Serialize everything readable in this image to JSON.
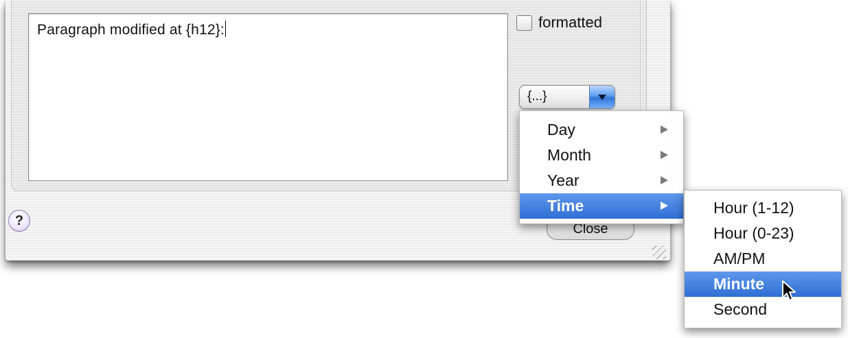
{
  "editor": {
    "text": "Paragraph modified at {h12}:"
  },
  "options": {
    "formatted_label": "formatted",
    "formatted_checked": false
  },
  "token_popup": {
    "value": "{...}"
  },
  "buttons": {
    "help_label": "?",
    "close_label": "Close"
  },
  "token_menu": {
    "items": [
      {
        "label": "Day",
        "has_submenu": true
      },
      {
        "label": "Month",
        "has_submenu": true
      },
      {
        "label": "Year",
        "has_submenu": true
      },
      {
        "label": "Time",
        "has_submenu": true,
        "selected": true
      }
    ]
  },
  "time_submenu": {
    "items": [
      {
        "label": "Hour (1-12)"
      },
      {
        "label": "Hour (0-23)"
      },
      {
        "label": "AM/PM"
      },
      {
        "label": "Minute",
        "selected": true
      },
      {
        "label": "Second"
      }
    ]
  }
}
